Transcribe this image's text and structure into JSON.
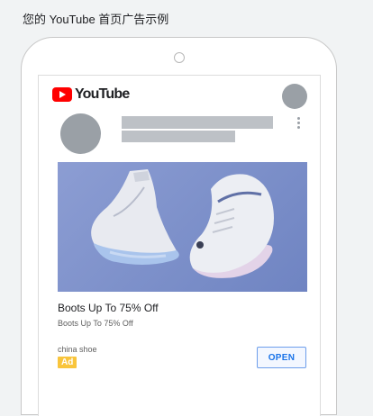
{
  "page": {
    "title": "您的 YouTube 首页广告示例"
  },
  "youtube": {
    "logo_text": "YouTube"
  },
  "ad": {
    "title": "Boots Up To 75% Off",
    "subtitle": "Boots Up To 75% Off",
    "advertiser": "china shoe",
    "badge": "Ad",
    "cta": "OPEN"
  },
  "colors": {
    "youtube_red": "#ff0000",
    "badge_yellow": "#f9c53c",
    "cta_blue": "#1a73e8",
    "placeholder_gray": "#bdc1c6"
  },
  "icons": [
    "youtube-play-icon",
    "more-vert-icon"
  ]
}
